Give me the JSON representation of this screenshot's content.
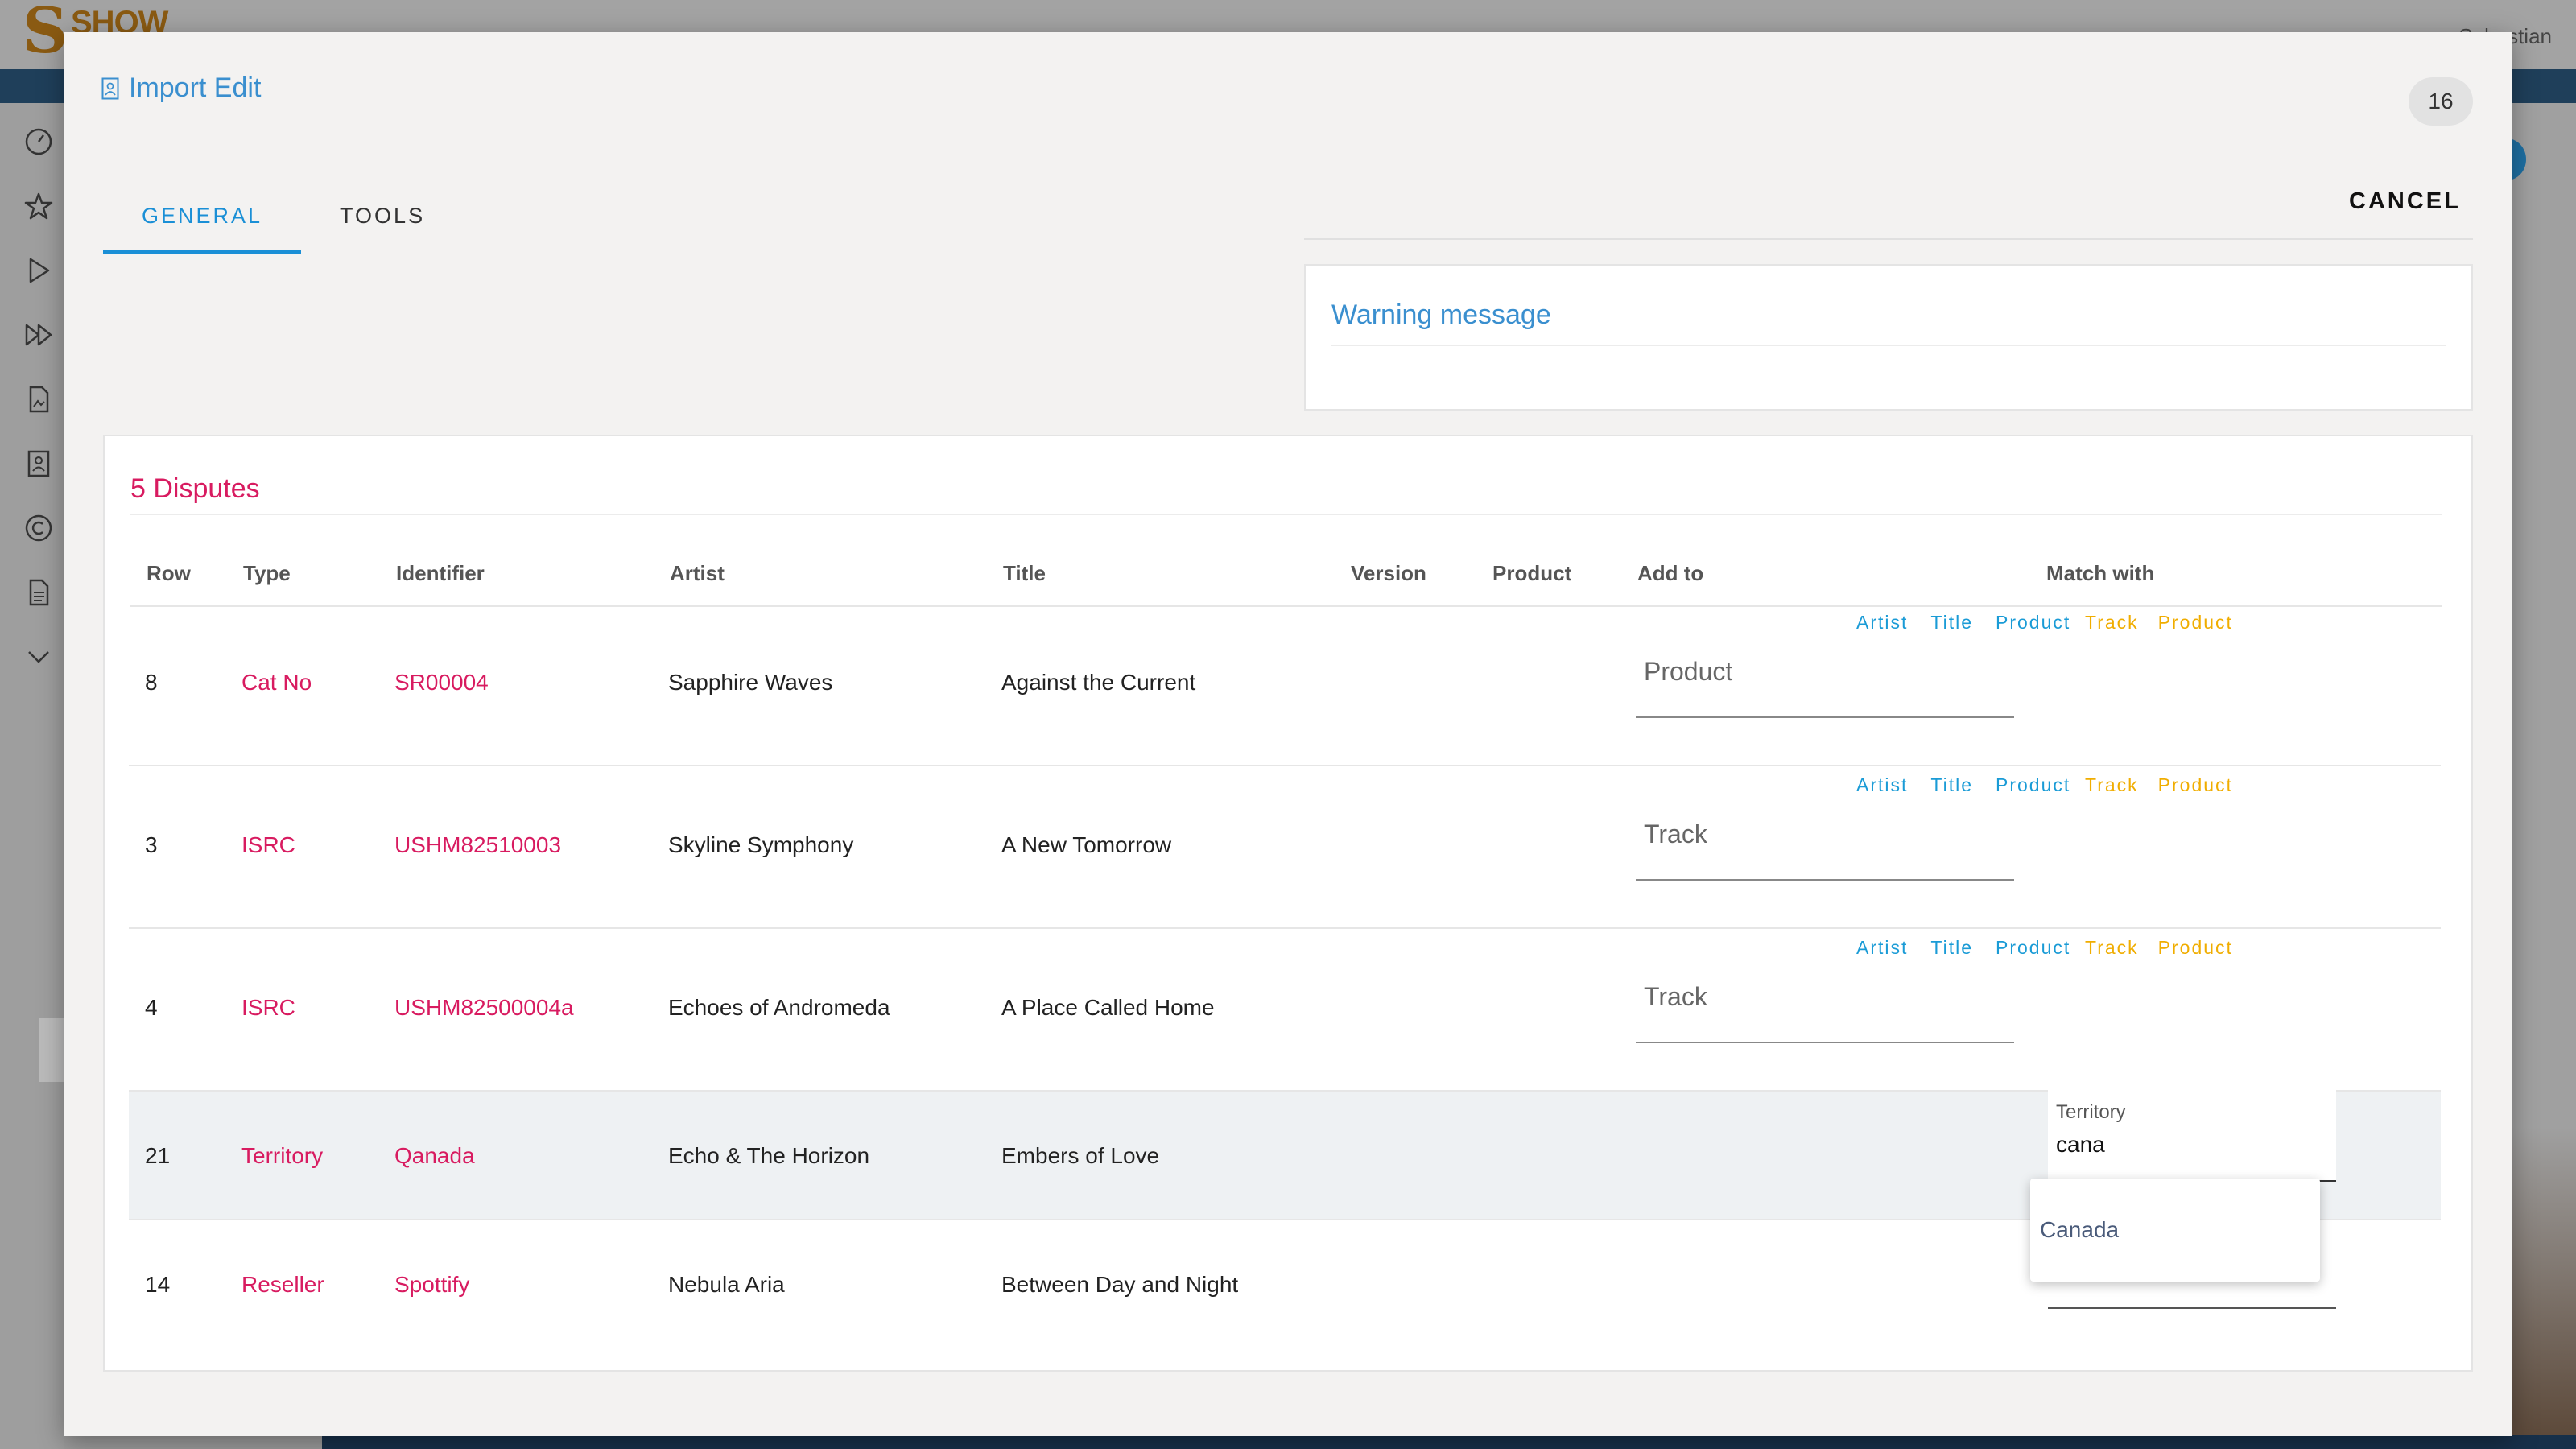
{
  "background": {
    "logo_text": "SHOW",
    "user_name": "Sebastian"
  },
  "modal": {
    "title": "Import Edit",
    "badge_count": "16",
    "tabs": [
      {
        "label": "GENERAL",
        "active": true
      },
      {
        "label": "TOOLS",
        "active": false
      }
    ],
    "cancel_label": "CANCEL",
    "warning": {
      "title": "Warning message"
    }
  },
  "disputes": {
    "title": "5 Disputes",
    "columns": [
      "Row",
      "Type",
      "Identifier",
      "Artist",
      "Title",
      "Version",
      "Product",
      "Add to",
      "Match with"
    ],
    "add_to_links": [
      "Artist",
      "Title",
      "Product"
    ],
    "match_with_links": [
      "Track",
      "Product"
    ],
    "rows": [
      {
        "row": "8",
        "type": "Cat No",
        "identifier": "SR00004",
        "artist": "Sapphire Waves",
        "title": "Against the Current",
        "add_to": "Product"
      },
      {
        "row": "3",
        "type": "ISRC",
        "identifier": "USHM82510003",
        "artist": "Skyline Symphony",
        "title": "A New Tomorrow",
        "add_to": "Track"
      },
      {
        "row": "4",
        "type": "ISRC",
        "identifier": "USHM82500004a",
        "artist": "Echoes of Andromeda",
        "title": "A Place Called Home",
        "add_to": "Track"
      },
      {
        "row": "21",
        "type": "Territory",
        "identifier": "Qanada",
        "artist": "Echo & The Horizon",
        "title": "Embers of Love",
        "match_field_label": "Territory",
        "match_field_value": "cana"
      },
      {
        "row": "14",
        "type": "Reseller",
        "identifier": "Spottify",
        "artist": "Nebula Aria",
        "title": "Between Day and Night"
      }
    ],
    "dropdown_options": [
      "Canada"
    ]
  },
  "colors": {
    "accent_blue": "#1a8fd6",
    "title_blue": "#3a8fcf",
    "dispute_pink": "#d81b60",
    "match_yellow": "#f0ad00"
  }
}
